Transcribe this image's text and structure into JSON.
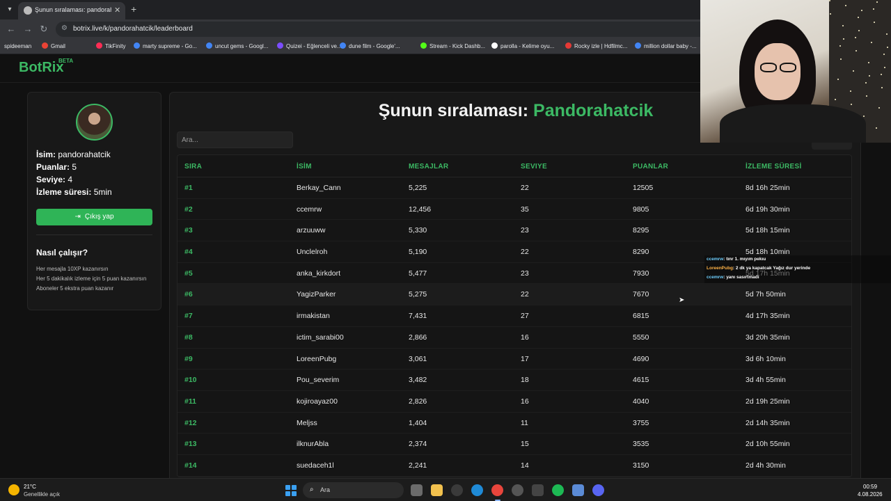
{
  "browser": {
    "tab_title": "Şunun sıralaması: pandorahatcik",
    "url": "botrix.live/k/pandorahatcik/leaderboard",
    "bookmarks": [
      {
        "label": "spideeman",
        "color": "#444444"
      },
      {
        "label": "Gmail",
        "color": "#ea4335"
      },
      {
        "label": "TikFinity",
        "color": "#ff2d55"
      },
      {
        "label": "marty supreme - Go...",
        "color": "#4285f4"
      },
      {
        "label": "uncut gems - Googl...",
        "color": "#4285f4"
      },
      {
        "label": "Quizei - Eğlenceli ve...",
        "color": "#7c4dff"
      },
      {
        "label": "dune film - Google'...",
        "color": "#4285f4"
      },
      {
        "label": "Stream - Kick Dashb...",
        "color": "#53fc18"
      },
      {
        "label": "parolla - Kelime oyu...",
        "color": "#ffffff"
      },
      {
        "label": "Rocky izle | Hdfilmc...",
        "color": "#e53935"
      },
      {
        "label": "million dollar baby -...",
        "color": "#4285f4"
      }
    ]
  },
  "brand": {
    "name": "BotRix",
    "badge": "BETA"
  },
  "profile": {
    "name_label": "İsim:",
    "name_value": "pandorahatcik",
    "points_label": "Puanlar:",
    "points_value": "5",
    "level_label": "Seviye:",
    "level_value": "4",
    "watch_label": "İzleme süresi:",
    "watch_value": "5min",
    "logout_label": "Çıkış yap"
  },
  "how": {
    "title": "Nasıl çalışır?",
    "lines": [
      "Her mesajla 10XP kazanırsın",
      "Her 5 dakikalık izleme için 5 puan kazanırsın",
      "Aboneler 5 ekstra puan kazanır"
    ]
  },
  "leaderboard": {
    "heading_prefix": "Şunun sıralaması:",
    "heading_name": "Pandorahatcik",
    "search_placeholder": "Ara...",
    "columns": [
      "SIRA",
      "İSİM",
      "MESAJLAR",
      "SEVIYE",
      "PUANLAR",
      "İZLEME SÜRESİ"
    ],
    "rows": [
      [
        "#1",
        "Berkay_Cann",
        "5,225",
        "22",
        "12505",
        "8d 16h 25min"
      ],
      [
        "#2",
        "ccemrw",
        "12,456",
        "35",
        "9805",
        "6d 19h 30min"
      ],
      [
        "#3",
        "arzuuww",
        "5,330",
        "23",
        "8295",
        "5d 18h 15min"
      ],
      [
        "#4",
        "Unclelroh",
        "5,190",
        "22",
        "8290",
        "5d 18h 10min"
      ],
      [
        "#5",
        "anka_kirkdort",
        "5,477",
        "23",
        "7930",
        "5d 17h 15min"
      ],
      [
        "#6",
        "YagizParker",
        "5,275",
        "22",
        "7670",
        "5d 7h 50min"
      ],
      [
        "#7",
        "irmakistan",
        "7,431",
        "27",
        "6815",
        "4d 17h 35min"
      ],
      [
        "#8",
        "ictim_sarabi00",
        "2,866",
        "16",
        "5550",
        "3d 20h 35min"
      ],
      [
        "#9",
        "LoreenPubg",
        "3,061",
        "17",
        "4690",
        "3d 6h 10min"
      ],
      [
        "#10",
        "Pou_severim",
        "3,482",
        "18",
        "4615",
        "3d 4h 55min"
      ],
      [
        "#11",
        "kojiroayaz00",
        "2,826",
        "16",
        "4040",
        "2d 19h 25min"
      ],
      [
        "#12",
        "Meljss",
        "1,404",
        "11",
        "3755",
        "2d 14h 35min"
      ],
      [
        "#13",
        "ilknurAbla",
        "2,374",
        "15",
        "3535",
        "2d 10h 55min"
      ],
      [
        "#14",
        "suedaceh1l",
        "2,241",
        "14",
        "3150",
        "2d 4h 30min"
      ]
    ]
  },
  "chat": [
    {
      "user": "ccemrw",
      "msg": ": tınr 1. mıyım pekıu"
    },
    {
      "user": "LoreenPubg",
      "msg": ": 2 dk ya kapatcak Yağız dur yerinde"
    },
    {
      "user": "ccemrw",
      "msg": ": yanı sasırtmadı"
    }
  ],
  "taskbar": {
    "temp": "21°C",
    "weather": "Genellikle açık",
    "search": "Ara",
    "time": "00:59",
    "date": "4.08.2026"
  },
  "colors": {
    "accent": "#3cb964",
    "background": "#111111"
  }
}
